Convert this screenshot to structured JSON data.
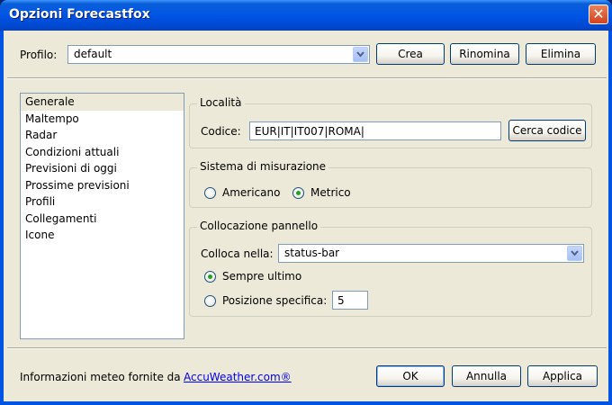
{
  "window": {
    "title": "Opzioni Forecastfox",
    "close_icon": "close-icon"
  },
  "profile": {
    "label": "Profilo:",
    "selected": "default",
    "buttons": {
      "create": "Crea",
      "rename": "Rinomina",
      "delete": "Elimina"
    }
  },
  "categories": [
    "Generale",
    "Maltempo",
    "Radar",
    "Condizioni attuali",
    "Previsioni di oggi",
    "Prossime previsioni",
    "Profili",
    "Collegamenti",
    "Icone"
  ],
  "location": {
    "group_title": "Località",
    "code_label": "Codice:",
    "code_value": "EUR|IT|IT007|ROMA|",
    "search_button": "Cerca codice"
  },
  "units": {
    "group_title": "Sistema di misurazione",
    "american": "Americano",
    "metric": "Metrico",
    "selected": "metric"
  },
  "panel": {
    "group_title": "Collocazione pannello",
    "place_label": "Colloca nella:",
    "place_value": "status-bar",
    "always_last": "Sempre ultimo",
    "specific_position": "Posizione specifica:",
    "position_value": "5",
    "selected": "always_last"
  },
  "footer": {
    "info_text": "Informazioni meteo fornite da",
    "link_text": "AccuWeather.com®",
    "buttons": {
      "ok": "OK",
      "cancel": "Annulla",
      "apply": "Applica"
    }
  },
  "colors": {
    "titlebar": "#0055e5",
    "dialog_bg": "#ece9d8",
    "link": "#0000ee",
    "radio_dot": "#21a121"
  }
}
